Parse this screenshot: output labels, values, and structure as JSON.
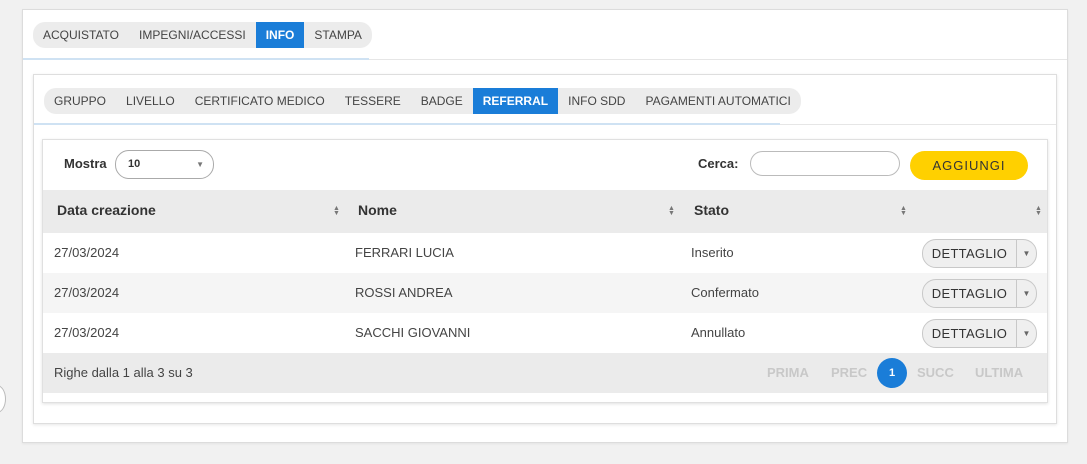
{
  "outer_tabs": [
    "ACQUISTATO",
    "IMPEGNI/ACCESSI",
    "INFO",
    "STAMPA"
  ],
  "outer_active": "INFO",
  "inner_tabs": [
    "GRUPPO",
    "LIVELLO",
    "CERTIFICATO MEDICO",
    "TESSERE",
    "BADGE",
    "REFERRAL",
    "INFO SDD",
    "PAGAMENTI AUTOMATICI"
  ],
  "inner_active": "REFERRAL",
  "toolbar": {
    "show_label": "Mostra",
    "show_value": "10",
    "search_label": "Cerca:",
    "search_value": "",
    "add_label": "AGGIUNGI"
  },
  "table": {
    "columns": [
      "Data creazione",
      "Nome",
      "Stato",
      ""
    ],
    "rows": [
      {
        "date": "27/03/2024",
        "name": "FERRARI LUCIA",
        "status": "Inserito",
        "action": "DETTAGLIO"
      },
      {
        "date": "27/03/2024",
        "name": "ROSSI ANDREA",
        "status": "Confermato",
        "action": "DETTAGLIO"
      },
      {
        "date": "27/03/2024",
        "name": "SACCHI GIOVANNI",
        "status": "Annullato",
        "action": "DETTAGLIO"
      }
    ],
    "footer_info": "Righe dalla 1 alla 3 su 3"
  },
  "pagination": {
    "first": "PRIMA",
    "prev": "PREC",
    "current": "1",
    "next": "SUCC",
    "last": "ULTIMA"
  },
  "colors": {
    "accent_blue": "#1a7dd8",
    "add_button_yellow": "#ffd000",
    "header_gray": "#ebebeb"
  }
}
